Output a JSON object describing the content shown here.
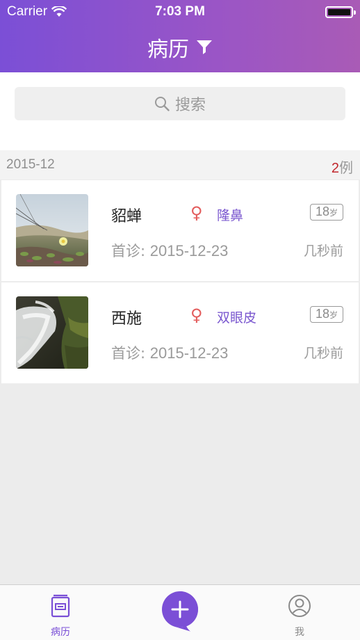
{
  "status_bar": {
    "carrier": "Carrier",
    "time": "7:03 PM"
  },
  "nav": {
    "title": "病历"
  },
  "search": {
    "placeholder": "搜索"
  },
  "section": {
    "date": "2015-12",
    "count": "2",
    "count_unit": "例"
  },
  "records": [
    {
      "name": "貂蝉",
      "gender_symbol": "♀",
      "procedure": "隆鼻",
      "age": "18",
      "age_unit": "岁",
      "first_visit_label": "首诊:",
      "first_visit_date": "2015-12-23",
      "time_ago": "几秒前"
    },
    {
      "name": "西施",
      "gender_symbol": "♀",
      "procedure": "双眼皮",
      "age": "18",
      "age_unit": "岁",
      "first_visit_label": "首诊:",
      "first_visit_date": "2015-12-23",
      "time_ago": "几秒前"
    }
  ],
  "tabs": [
    {
      "label": "病历",
      "icon": "records-icon",
      "active": true
    },
    {
      "label": "",
      "icon": "plus-icon"
    },
    {
      "label": "我",
      "icon": "user-icon",
      "active": false
    }
  ],
  "colors": {
    "accent": "#7b4fd6",
    "gradient_end": "#a95bb6",
    "female": "#e35d5d",
    "count_red": "#c1272d"
  }
}
